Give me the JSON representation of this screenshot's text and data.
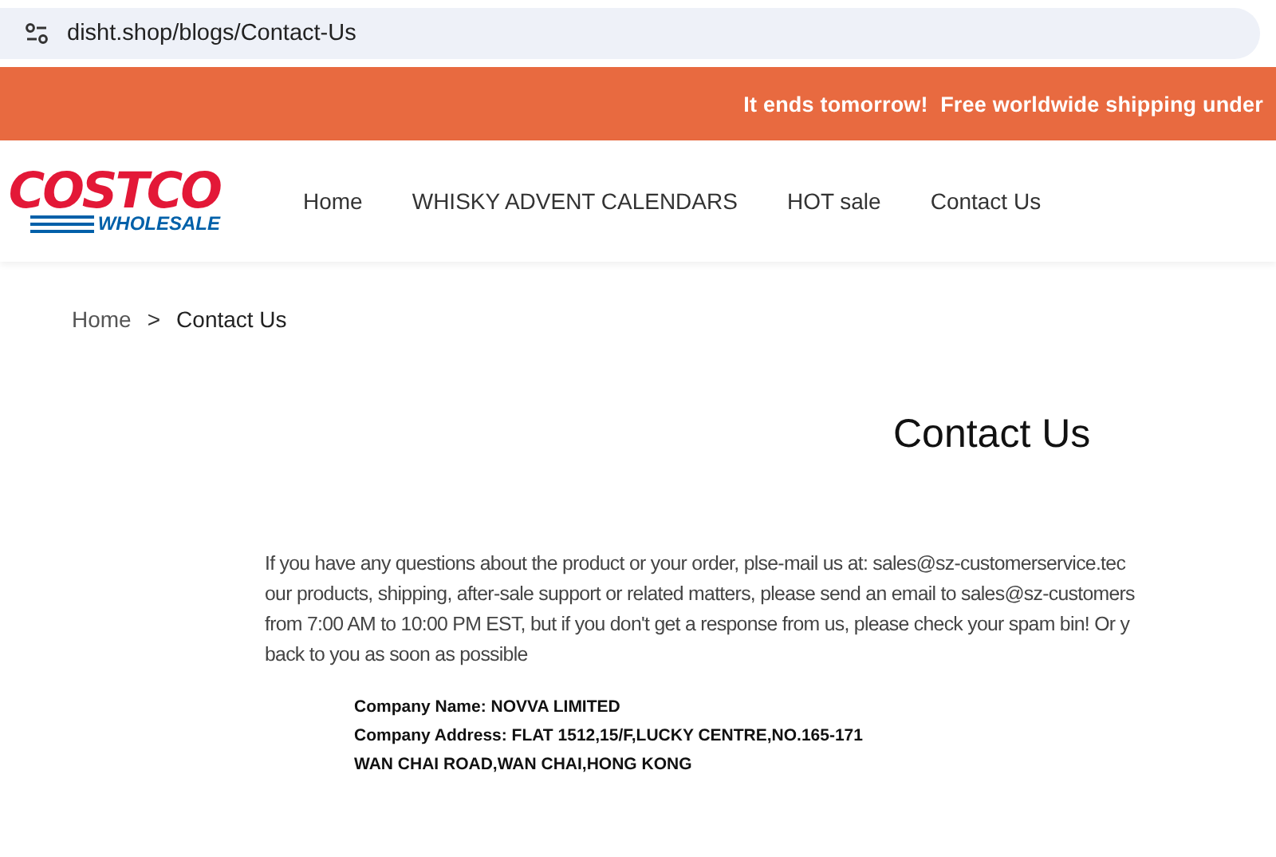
{
  "address_bar": {
    "url": "disht.shop/blogs/Contact-Us"
  },
  "announcement": {
    "text": "It ends tomorrow!  Free worldwide shipping under"
  },
  "logo": {
    "top": "COSTCO",
    "bottom": "WHOLESALE"
  },
  "nav": [
    {
      "label": "Home"
    },
    {
      "label": "WHISKY ADVENT CALENDARS"
    },
    {
      "label": "HOT sale"
    },
    {
      "label": "Contact Us"
    }
  ],
  "breadcrumb": {
    "items": [
      {
        "label": "Home"
      },
      {
        "label": "Contact Us"
      }
    ],
    "separator": ">"
  },
  "heading": "Contact Us",
  "body_lines": [
    "If you have any questions about the product or your order, plse-mail us at: sales@sz-customerservice.tec",
    "our products, shipping, after-sale support or related matters, please send an email to sales@sz-customers",
    "from 7:00 AM to 10:00 PM EST, but if you don't get a response from us, please check your spam bin! Or y",
    "back to you as soon as possible"
  ],
  "company_lines": [
    "Company Name: NOVVA LIMITED",
    "Company Address: FLAT 1512,15/F,LUCKY CENTRE,NO.165-171",
    "WAN CHAI ROAD,WAN CHAI,HONG KONG"
  ]
}
